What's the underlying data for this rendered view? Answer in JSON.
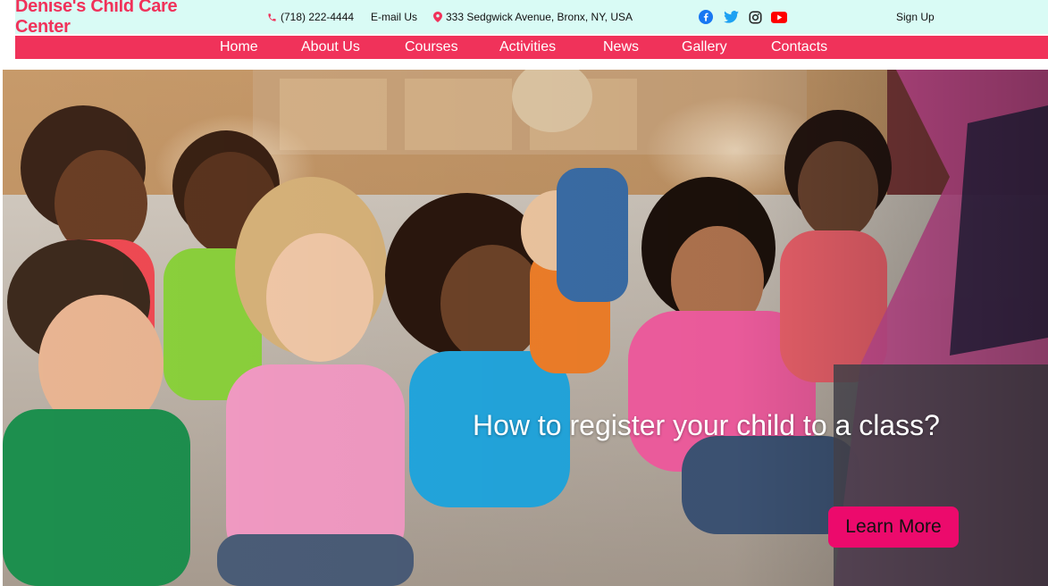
{
  "brand": {
    "name": "Denise's Child Care Center"
  },
  "contact": {
    "phone": "(718) 222-4444",
    "email_label": "E-mail Us",
    "address": "333 Sedgwick Avenue, Bronx, NY, USA"
  },
  "social": {
    "icons": [
      "facebook-icon",
      "twitter-icon",
      "instagram-icon",
      "youtube-icon"
    ]
  },
  "account": {
    "signup_label": "Sign Up"
  },
  "nav": {
    "items": [
      {
        "label": "Home"
      },
      {
        "label": "About Us"
      },
      {
        "label": "Courses"
      },
      {
        "label": "Activities"
      },
      {
        "label": "News"
      },
      {
        "label": "Gallery"
      },
      {
        "label": "Contacts"
      }
    ]
  },
  "hero": {
    "title": "How to register your child to a class?",
    "button_label": "Learn More"
  },
  "colors": {
    "brand_accent": "#f0325a",
    "header_bg": "#d9fbf5",
    "button_bg": "#ec0a6c",
    "facebook": "#1877f2",
    "twitter": "#1da1f2",
    "youtube": "#ff0000"
  }
}
